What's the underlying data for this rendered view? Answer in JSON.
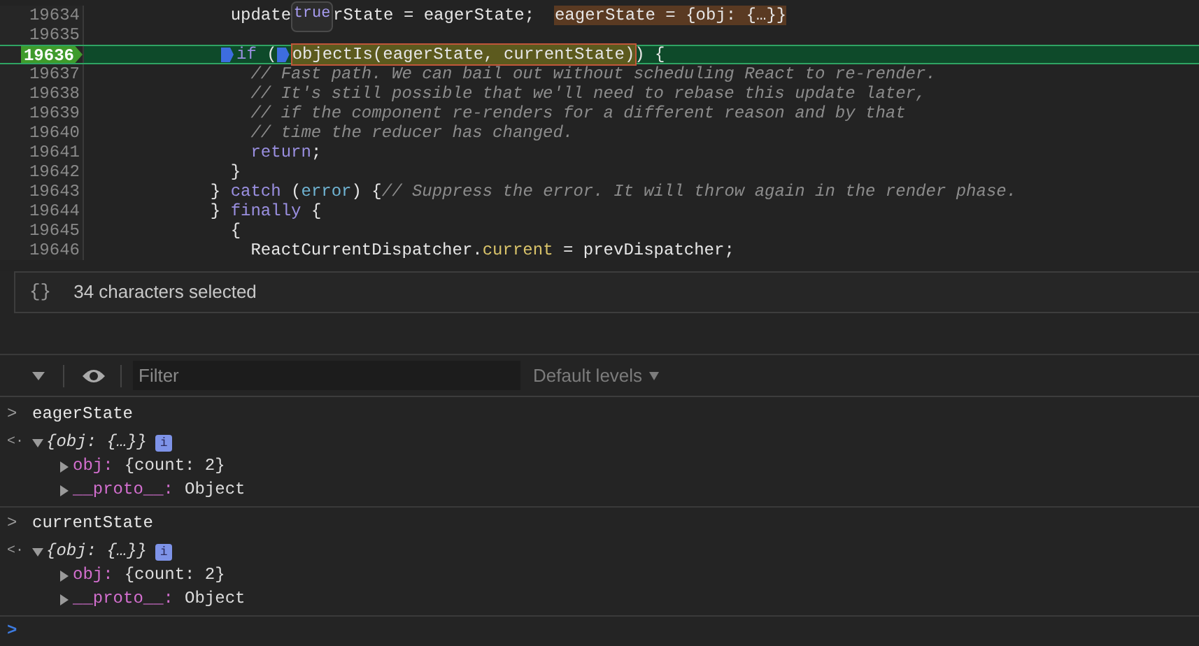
{
  "editor": {
    "lines": [
      {
        "number": "19634",
        "paused": false,
        "tokens": [
          {
            "kind": "plain",
            "text": "              update"
          },
          {
            "kind": "tooltip",
            "text": "true"
          },
          {
            "kind": "plain",
            "text": "rState = eagerState;  "
          },
          {
            "kind": "inline_value",
            "text": "eagerState = {obj: {…}}"
          }
        ]
      },
      {
        "number": "19635",
        "paused": false
      },
      {
        "number": "19636",
        "paused": true,
        "tokens": [
          {
            "kind": "breakpoint_marker"
          },
          {
            "kind": "keyword",
            "text": "if"
          },
          {
            "kind": "plain",
            "text": " ("
          },
          {
            "kind": "breakpoint_marker"
          },
          {
            "kind": "selection",
            "text": "objectIs(eagerState, currentState)"
          },
          {
            "kind": "plain",
            "text": ") {"
          }
        ]
      },
      {
        "number": "19637",
        "paused": false,
        "tokens": [
          {
            "kind": "comment",
            "text": "                // Fast path. We can bail out without scheduling React to re-render."
          }
        ]
      },
      {
        "number": "19638",
        "paused": false,
        "tokens": [
          {
            "kind": "comment",
            "text": "                // It's still possible that we'll need to rebase this update later,"
          }
        ]
      },
      {
        "number": "19639",
        "paused": false,
        "tokens": [
          {
            "kind": "comment",
            "text": "                // if the component re-renders for a different reason and by that"
          }
        ]
      },
      {
        "number": "19640",
        "paused": false,
        "tokens": [
          {
            "kind": "comment",
            "text": "                // time the reducer has changed."
          }
        ]
      },
      {
        "number": "19641",
        "paused": false,
        "tokens": [
          {
            "kind": "keyword",
            "text": "                return"
          },
          {
            "kind": "plain",
            "text": ";"
          }
        ]
      },
      {
        "number": "19642",
        "paused": false,
        "tokens": [
          {
            "kind": "plain",
            "text": "              }"
          }
        ]
      },
      {
        "number": "19643",
        "paused": false,
        "tokens": [
          {
            "kind": "plain",
            "text": "            } "
          },
          {
            "kind": "keyword",
            "text": "catch"
          },
          {
            "kind": "plain",
            "text": " ("
          },
          {
            "kind": "param",
            "text": "error"
          },
          {
            "kind": "plain",
            "text": ") {"
          },
          {
            "kind": "comment",
            "text": "// Suppress the error. It will throw again in the render phase."
          }
        ]
      },
      {
        "number": "19644",
        "paused": false,
        "tokens": [
          {
            "kind": "plain",
            "text": "            } "
          },
          {
            "kind": "keyword",
            "text": "finally"
          },
          {
            "kind": "plain",
            "text": " {"
          }
        ]
      },
      {
        "number": "19645",
        "paused": false,
        "tokens": [
          {
            "kind": "plain",
            "text": "              {"
          }
        ]
      },
      {
        "number": "19646",
        "paused": false,
        "tokens": [
          {
            "kind": "plain",
            "text": "                ReactCurrentDispatcher."
          },
          {
            "kind": "property",
            "text": "current"
          },
          {
            "kind": "plain",
            "text": " = prevDispatcher;"
          }
        ]
      }
    ]
  },
  "status_bar": {
    "icon_text": "{}",
    "text": "34 characters selected"
  },
  "console_toolbar": {
    "filter": {
      "placeholder": "Filter"
    },
    "levels": "Default levels"
  },
  "console": [
    {
      "kind": "input",
      "prompt": ">",
      "text": "eagerState"
    },
    {
      "kind": "result",
      "prompt": "<·",
      "summary": "{obj: {…}}",
      "expanded": true,
      "badge": "i",
      "children": [
        {
          "key": "obj:",
          "value": "{count: 2}",
          "expanded": false
        },
        {
          "key": "__proto__:",
          "value": "Object",
          "expanded": false
        }
      ]
    },
    {
      "kind": "input",
      "prompt": ">",
      "text": "currentState"
    },
    {
      "kind": "result",
      "prompt": "<·",
      "summary": "{obj: {…}}",
      "expanded": true,
      "badge": "i",
      "children": [
        {
          "key": "obj:",
          "value": "{count: 2}",
          "expanded": false
        },
        {
          "key": "__proto__:",
          "value": "Object",
          "expanded": false
        }
      ]
    },
    {
      "kind": "prompt",
      "prompt": ">"
    }
  ]
}
